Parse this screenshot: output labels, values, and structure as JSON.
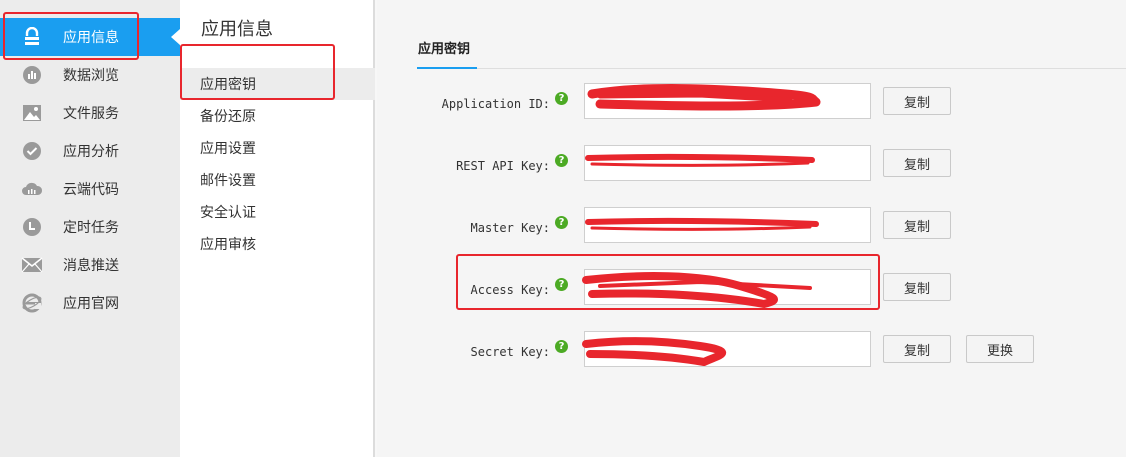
{
  "nav": {
    "items": [
      {
        "label": "应用信息",
        "icon": "lock-icon",
        "active": true
      },
      {
        "label": "数据浏览",
        "icon": "bar-chart-icon"
      },
      {
        "label": "文件服务",
        "icon": "image-icon"
      },
      {
        "label": "应用分析",
        "icon": "check-circle-icon"
      },
      {
        "label": "云端代码",
        "icon": "cloud-icon"
      },
      {
        "label": "定时任务",
        "icon": "clock-icon"
      },
      {
        "label": "消息推送",
        "icon": "envelope-icon"
      },
      {
        "label": "应用官网",
        "icon": "ie-icon"
      }
    ]
  },
  "subnav": {
    "title": "应用信息",
    "items": [
      "应用密钥",
      "备份还原",
      "应用设置",
      "邮件设置",
      "安全认证",
      "应用审核"
    ]
  },
  "main": {
    "section_title": "应用密钥",
    "rows": [
      {
        "label": "Application ID:",
        "value": "",
        "copy": "复制"
      },
      {
        "label": "REST API Key:",
        "value": "",
        "copy": "复制"
      },
      {
        "label": "Master Key:",
        "value": "",
        "copy": "复制"
      },
      {
        "label": "Access Key:",
        "value": "",
        "copy": "复制"
      },
      {
        "label": "Secret Key:",
        "value": "",
        "copy": "复制",
        "extra": "更换"
      }
    ],
    "help_glyph": "?"
  },
  "colors": {
    "accent": "#1a9ef0",
    "annotation": "#e8262d",
    "help": "#4caa24"
  }
}
